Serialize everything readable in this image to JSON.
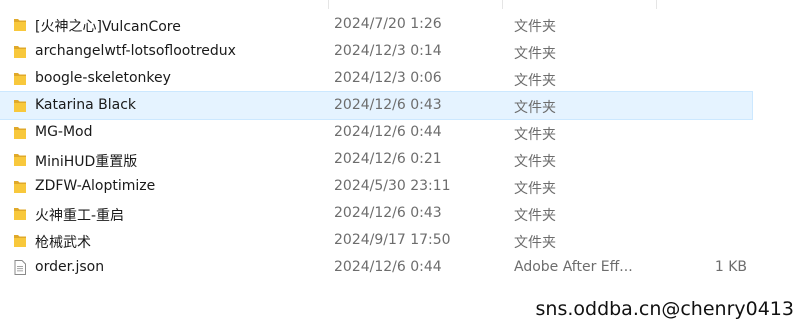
{
  "files": [
    {
      "name": "[火神之心]VulcanCore",
      "date": "2024/7/20 1:26",
      "type": "文件夹",
      "size": "",
      "icon": "folder-icon",
      "selected": false
    },
    {
      "name": "archangelwtf-lotsoflootredux",
      "date": "2024/12/3 0:14",
      "type": "文件夹",
      "size": "",
      "icon": "folder-icon",
      "selected": false
    },
    {
      "name": "boogle-skeletonkey",
      "date": "2024/12/3 0:06",
      "type": "文件夹",
      "size": "",
      "icon": "folder-icon",
      "selected": false
    },
    {
      "name": "Katarina Black",
      "date": "2024/12/6 0:43",
      "type": "文件夹",
      "size": "",
      "icon": "folder-icon",
      "selected": true
    },
    {
      "name": "MG-Mod",
      "date": "2024/12/6 0:44",
      "type": "文件夹",
      "size": "",
      "icon": "folder-icon",
      "selected": false
    },
    {
      "name": "MiniHUD重置版",
      "date": "2024/12/6 0:21",
      "type": "文件夹",
      "size": "",
      "icon": "folder-icon",
      "selected": false
    },
    {
      "name": "ZDFW-Aloptimize",
      "date": "2024/5/30 23:11",
      "type": "文件夹",
      "size": "",
      "icon": "folder-icon",
      "selected": false
    },
    {
      "name": "火神重工-重启",
      "date": "2024/12/6 0:43",
      "type": "文件夹",
      "size": "",
      "icon": "folder-icon",
      "selected": false
    },
    {
      "name": "枪械武术",
      "date": "2024/9/17 17:50",
      "type": "文件夹",
      "size": "",
      "icon": "folder-icon",
      "selected": false
    },
    {
      "name": "order.json",
      "date": "2024/12/6 0:44",
      "type": "Adobe After Eff...",
      "size": "1 KB",
      "icon": "json-file-icon",
      "selected": false
    }
  ],
  "watermark": "sns.oddba.cn@chenry0413",
  "colors": {
    "folder": "#f8c83c",
    "folder_dark": "#e0a92a",
    "selection_bg": "#e5f3ff",
    "secondary_text": "#6d6d6d"
  }
}
